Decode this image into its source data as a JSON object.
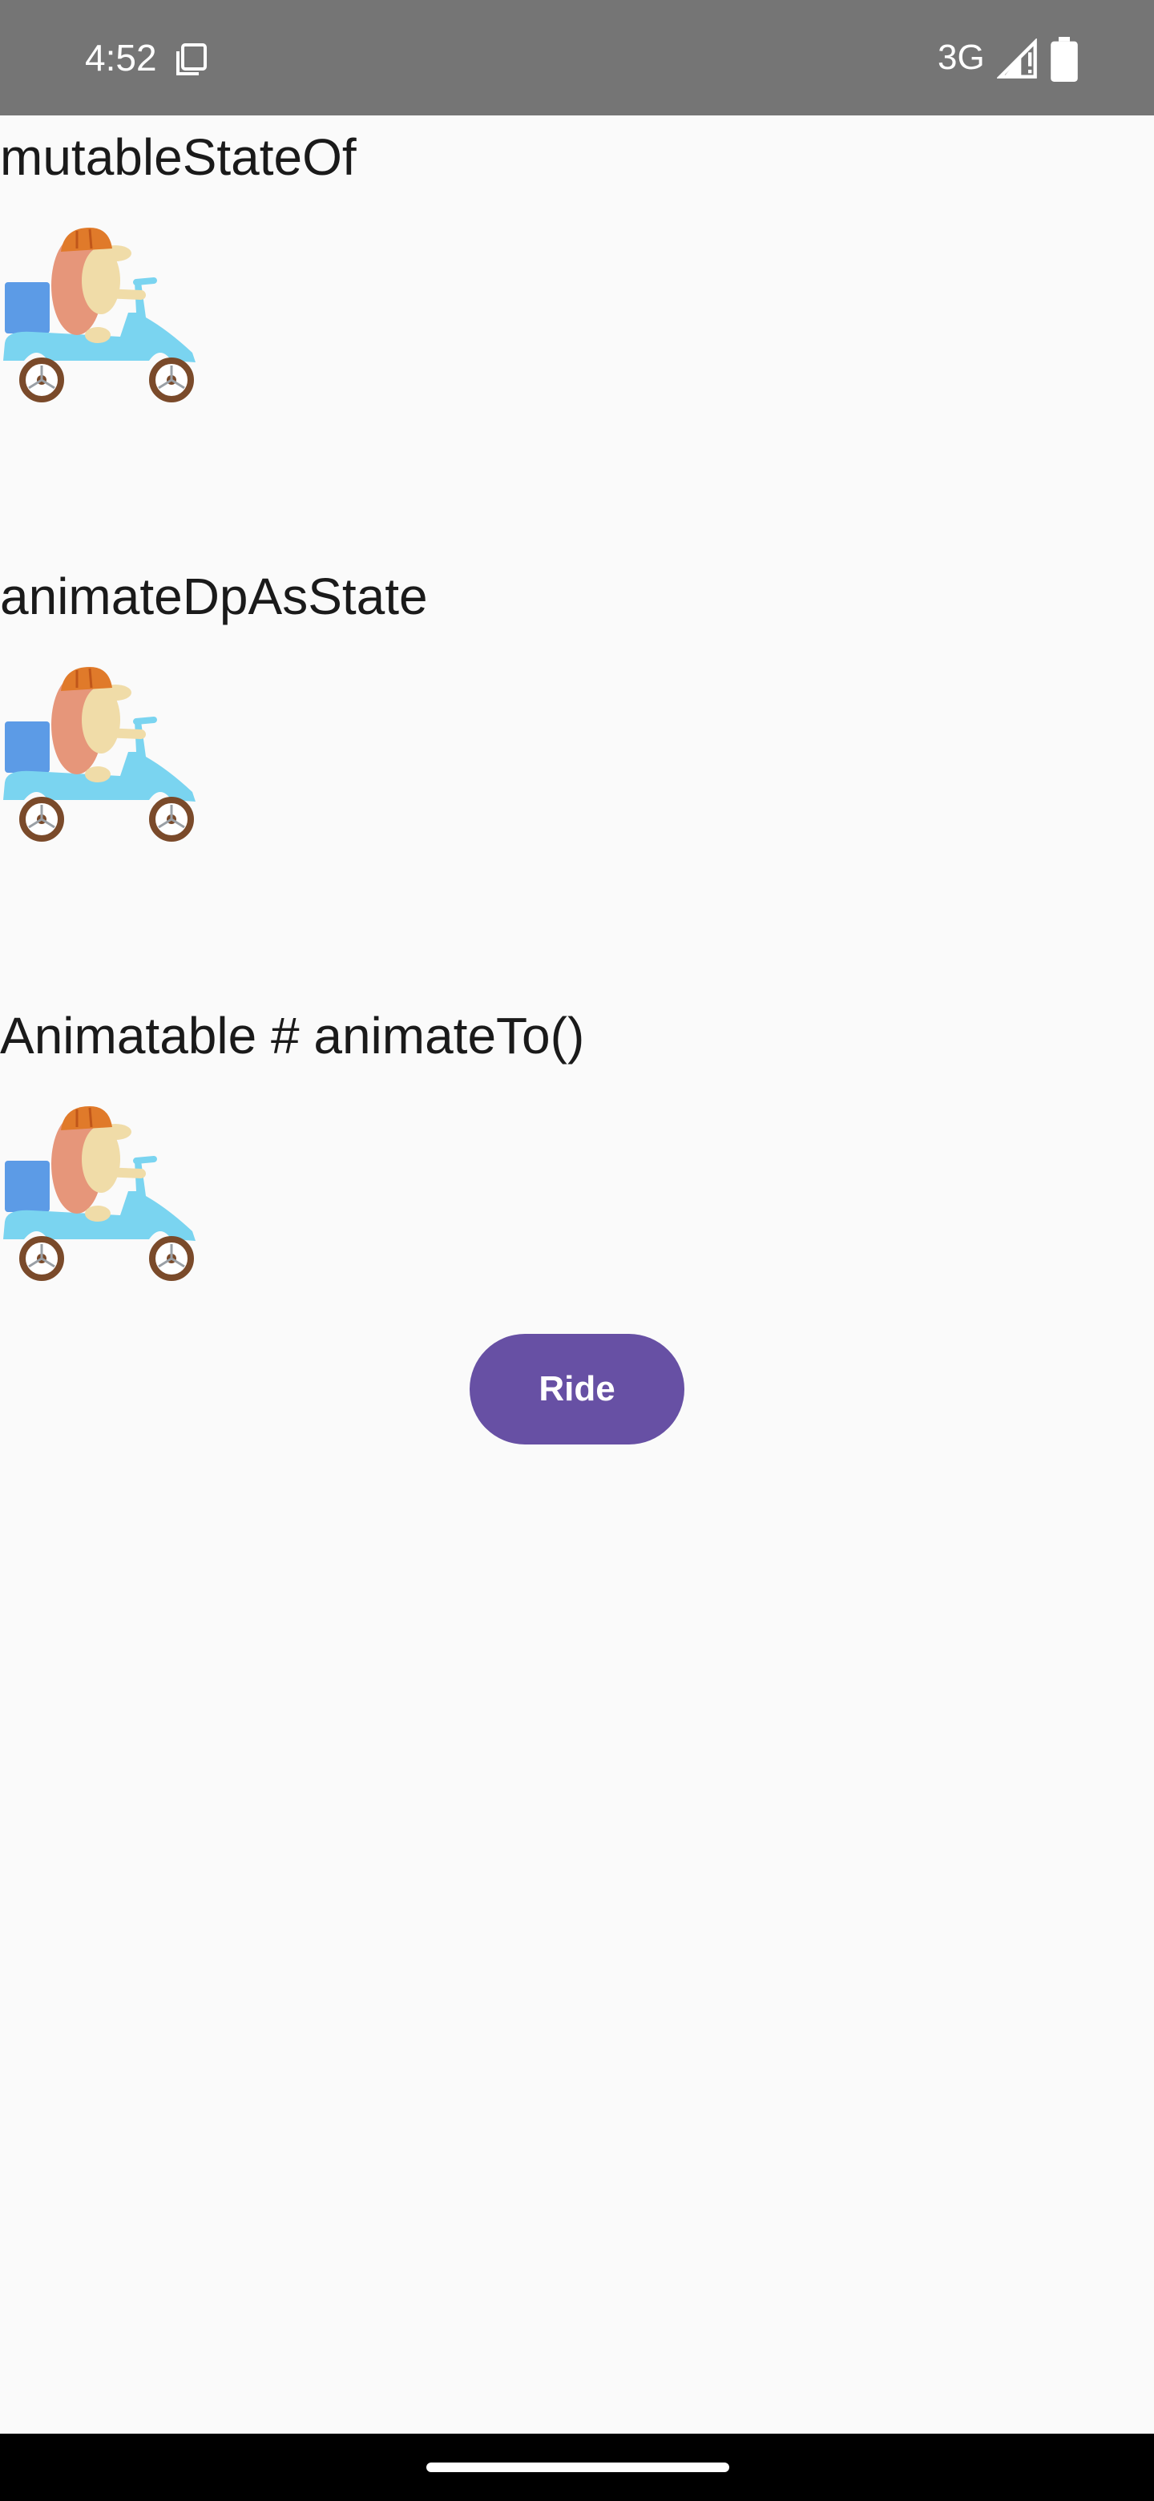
{
  "status_bar": {
    "time": "4:52",
    "network": "3G",
    "background_color": "#757575"
  },
  "sections": [
    {
      "title": "mutableStateOf",
      "image_icon": "hedgehog-scooter-icon"
    },
    {
      "title": "animateDpAsState",
      "image_icon": "hedgehog-scooter-icon"
    },
    {
      "title": "Animatable # animateTo()",
      "image_icon": "hedgehog-scooter-icon"
    }
  ],
  "ride_button": {
    "label": "Ride",
    "color": "#6750a4"
  },
  "navigation_bar": {
    "background_color": "#000000"
  }
}
